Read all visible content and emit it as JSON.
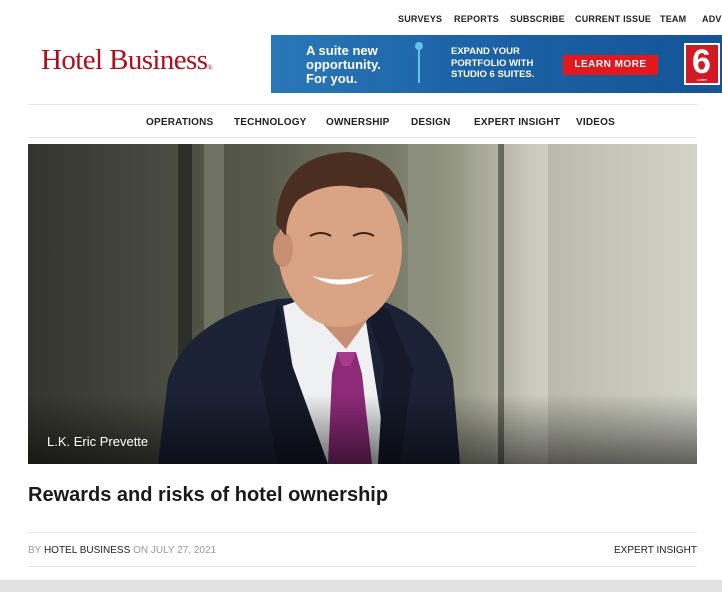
{
  "top_nav": [
    "SURVEYS",
    "REPORTS",
    "SUBSCRIBE",
    "CURRENT ISSUE",
    "TEAM",
    "ADVE"
  ],
  "logo": {
    "text": "HotelBusiness",
    "mark": "®"
  },
  "ad": {
    "headline": "A suite new\nopportunity.\nFor you.",
    "subtext": "EXPAND YOUR\nPORTFOLIO WITH\nSTUDIO 6 SUITES.",
    "cta": "LEARN MORE",
    "brand_number": "6",
    "brand_small": "suites"
  },
  "main_nav": [
    "OPERATIONS",
    "TECHNOLOGY",
    "OWNERSHIP",
    "DESIGN",
    "EXPERT INSIGHT",
    "VIDEOS"
  ],
  "hero": {
    "caption": "L.K. Eric Prevette"
  },
  "article": {
    "title": "Rewards and risks of hotel ownership",
    "by_label": "BY",
    "author": "HOTEL BUSINESS",
    "on_label": "ON",
    "date": "JULY 27, 2021",
    "category": "EXPERT INSIGHT"
  },
  "colors": {
    "brand_red": "#b0101e",
    "ad_blue": "#1d64a6",
    "cta_red": "#e3181f"
  }
}
